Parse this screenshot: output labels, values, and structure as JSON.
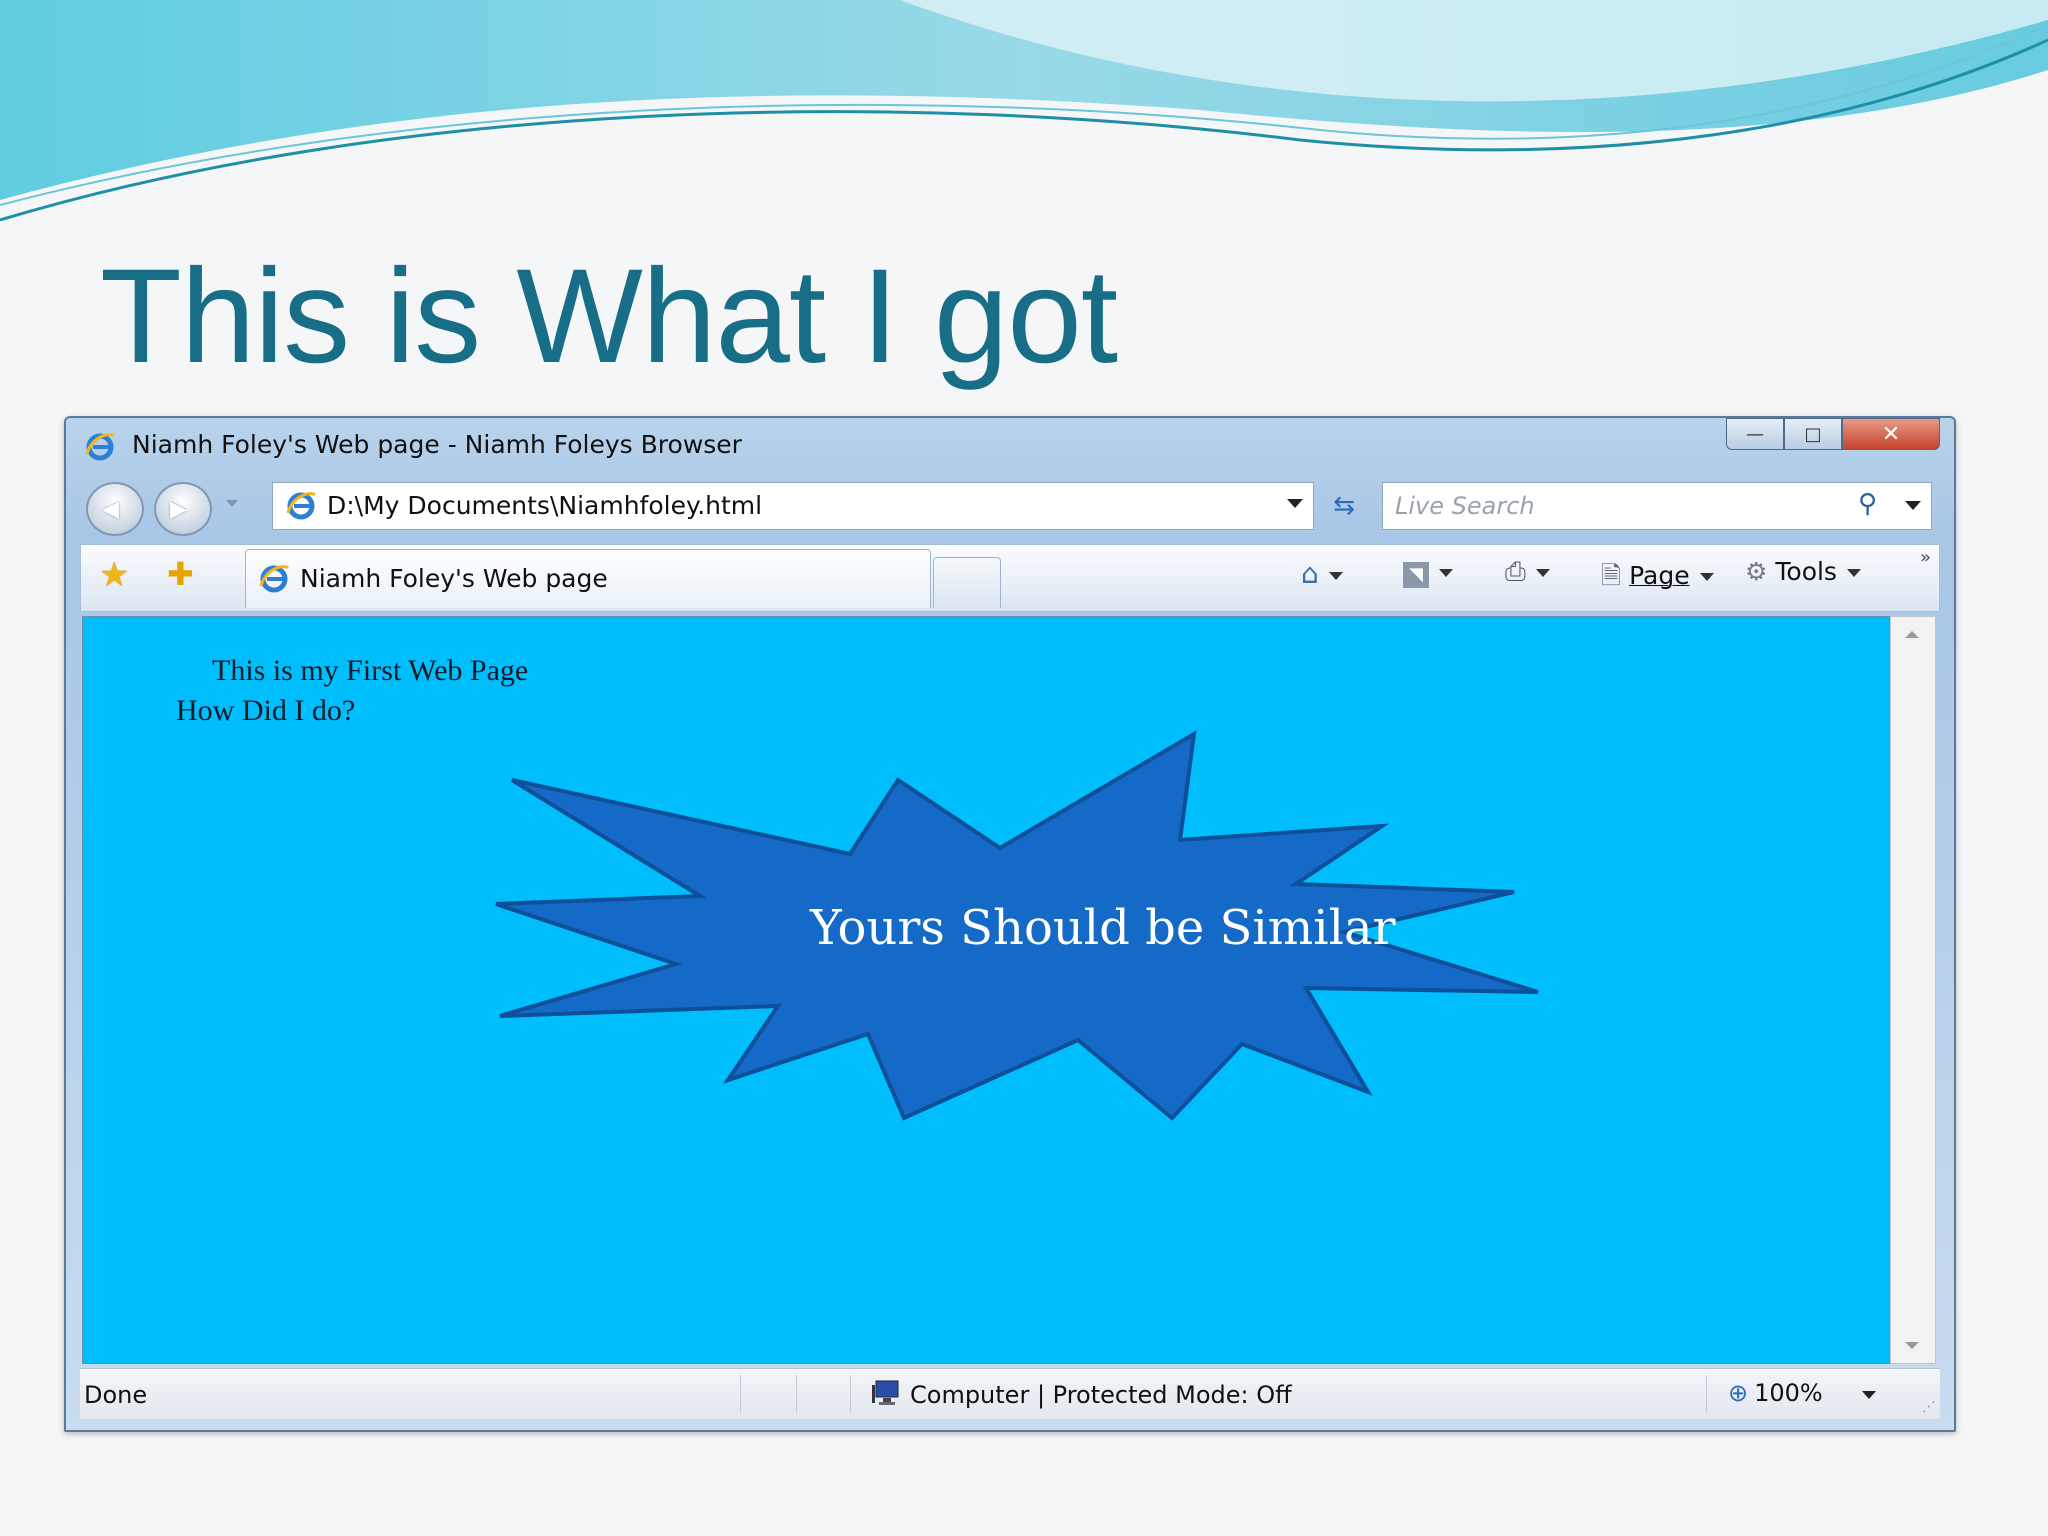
{
  "slide": {
    "title": "This is What I got"
  },
  "window": {
    "title": "Niamh Foley's Web page - Niamh Foleys Browser",
    "address": "D:\\My Documents\\Niamhfoley.html",
    "search_placeholder": "Live Search",
    "tab_label": "Niamh Foley's Web page",
    "tools": {
      "page_label": "Page",
      "tools_label": "Tools"
    },
    "controls": {
      "minimize": "—",
      "maximize": "□",
      "close": "✕"
    }
  },
  "page": {
    "line1": "This is my First Web Page",
    "line2": "How Did I do?",
    "starburst_text": "Yours Should be Similar",
    "background_color": "#00bdfb",
    "starburst_color": "#1569c7"
  },
  "status": {
    "left": "Done",
    "zone": "Computer | Protected Mode: Off",
    "zoom": "100%"
  },
  "icons": [
    "ie-icon",
    "back-icon",
    "forward-icon",
    "refresh-icon",
    "stop-icon",
    "search-icon",
    "favorites-star-icon",
    "add-favorites-icon",
    "home-icon",
    "feeds-icon",
    "print-icon",
    "page-icon",
    "tools-gear-icon",
    "computer-icon",
    "zoom-icon"
  ]
}
